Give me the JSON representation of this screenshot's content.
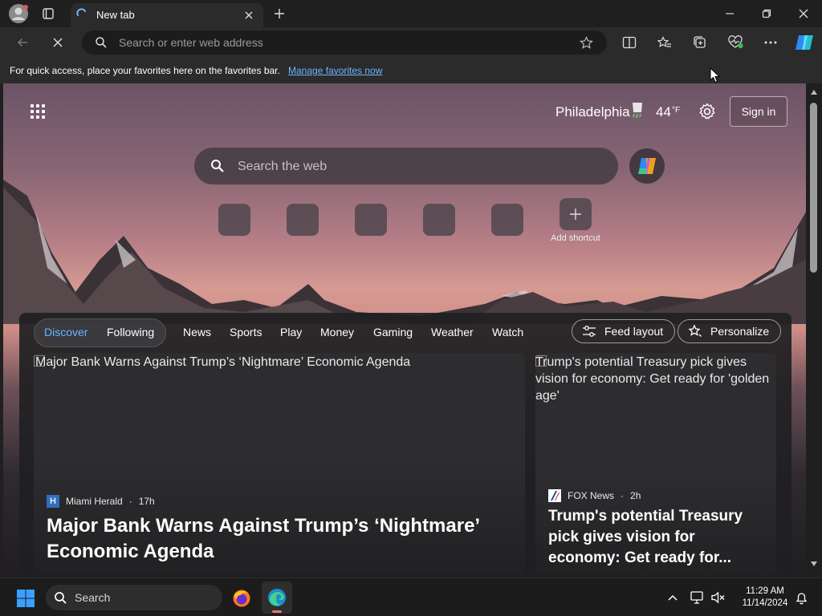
{
  "browser": {
    "tab_title": "New tab",
    "address_placeholder": "Search or enter web address"
  },
  "favorites_bar": {
    "message": "For quick access, place your favorites here on the favorites bar.",
    "link": "Manage favorites now"
  },
  "newtab": {
    "location": "Philadelphia",
    "temperature": "44",
    "temp_unit": "°F",
    "sign_in": "Sign in",
    "search_placeholder": "Search the web",
    "add_shortcut_label": "Add shortcut",
    "feed_tabs": [
      "Discover",
      "Following",
      "News",
      "Sports",
      "Play",
      "Money",
      "Gaming",
      "Weather",
      "Watch"
    ],
    "active_feed_tab": "Discover",
    "feed_layout_label": "Feed layout",
    "personalize_label": "Personalize"
  },
  "articles": [
    {
      "image_alt": "Major Bank Warns Against Trump’s ‘Nightmare’ Economic Agenda",
      "source": "Miami Herald",
      "age": "17h",
      "headline": "Major Bank Warns Against Trump’s ‘Nightmare’ Economic Agenda"
    },
    {
      "image_alt": "Trump's potential Treasury pick gives vision for economy: Get ready for 'golden age'",
      "source": "FOX News",
      "age": "2h",
      "headline": "Trump's potential Treasury pick gives vision for economy: Get ready for..."
    }
  ],
  "taskbar": {
    "search_label": "Search",
    "time": "11:29 AM",
    "date": "11/14/2024"
  },
  "colors": {
    "accent_link": "#6cb6ff",
    "discover_active": "#6cb6ff"
  }
}
